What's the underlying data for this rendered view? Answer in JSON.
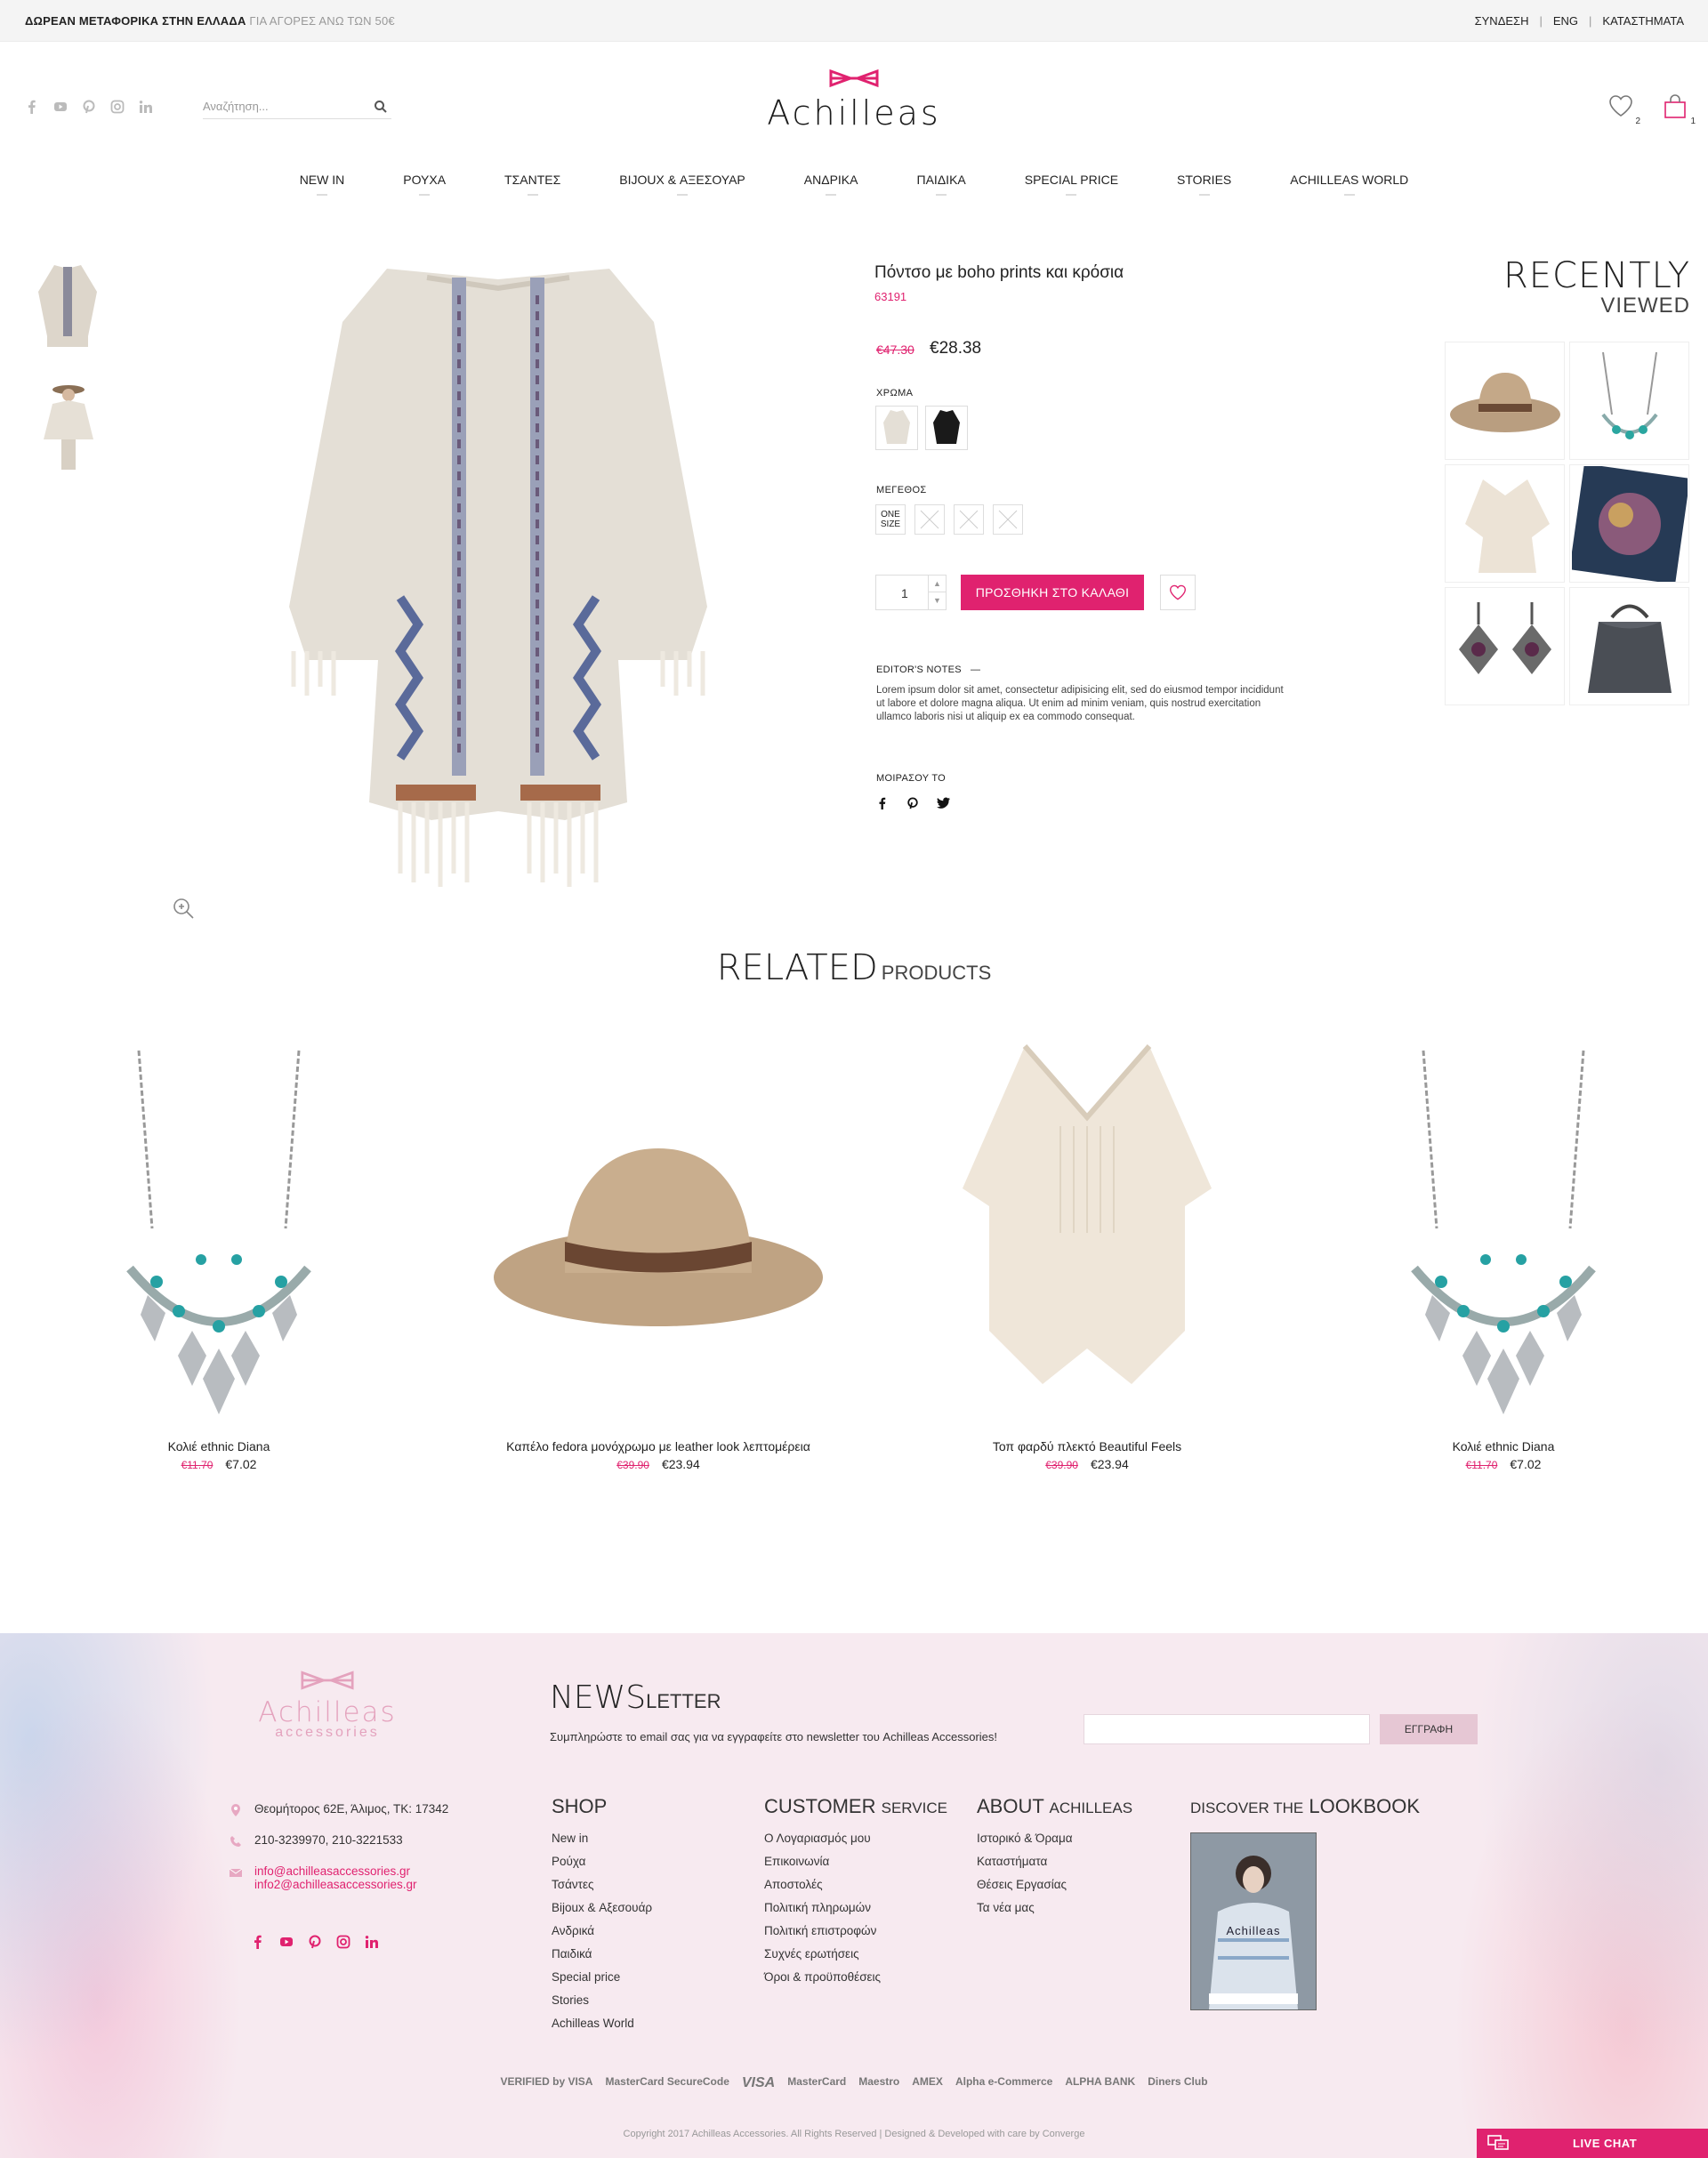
{
  "topbar": {
    "ship_bold": "ΔΩΡΕΑΝ ΜΕΤΑΦΟΡΙΚΑ ΣΤΗΝ ΕΛΛΑΔΑ",
    "ship_thin": "ΓΙΑ ΑΓΟΡΕΣ ΑΝΩ ΤΩΝ 50€",
    "links": [
      "ΣΥΝΔΕΣΗ",
      "ENG",
      "ΚΑΤΑΣΤΗΜΑΤΑ"
    ]
  },
  "header": {
    "search_placeholder": "Αναζήτηση...",
    "logo": "Achilleas",
    "wishlist_count": "2",
    "cart_count": "1",
    "social": [
      "facebook-icon",
      "youtube-icon",
      "pinterest-icon",
      "instagram-icon",
      "linkedin-icon"
    ]
  },
  "nav": [
    "NEW IN",
    "ΡΟΥΧΑ",
    "ΤΣΑΝΤΕΣ",
    "BIJOUX & ΑΞΕΣΟΥΑΡ",
    "ΑΝΔΡΙΚΑ",
    "ΠΑΙΔΙΚΑ",
    "SPECIAL PRICE",
    "STORIES",
    "ACHILLEAS WORLD"
  ],
  "product": {
    "title": "Πόντσο με boho prints και κρόσια",
    "sku": "63191",
    "old_price": "€47.30",
    "price": "€28.38",
    "color_label": "ΧΡΩΜΑ",
    "size_label": "ΜΕΓΕΘΟΣ",
    "size_one": "ONE SIZE",
    "quantity": "1",
    "add_to_cart": "ΠΡΟΣΘΗΚΗ ΣΤΟ ΚΑΛΑΘΙ",
    "notes_label": "EDITOR'S NOTES",
    "notes": "Lorem ipsum dolor sit amet, consectetur adipisicing elit, sed do eiusmod tempor incididunt ut labore et dolore magna aliqua. Ut enim ad minim veniam, quis nostrud exercitation ullamco laboris nisi ut aliquip ex ea commodo consequat.",
    "share_label": "ΜΟΙΡΑΣΟΥ ΤΟ"
  },
  "recently": {
    "title_a": "RECENTLY",
    "title_b": "VIEWED"
  },
  "related": {
    "title_a": "RELATED",
    "title_b": "PRODUCTS",
    "items": [
      {
        "name": "Κολιέ ethnic Diana",
        "old": "€11.70",
        "price": "€7.02"
      },
      {
        "name": "Καπέλο fedora μονόχρωμο με leather look λεπτομέρεια",
        "old": "€39.90",
        "price": "€23.94"
      },
      {
        "name": "Τοπ φαρδύ πλεκτό Beautiful Feels",
        "old": "€39.90",
        "price": "€23.94"
      },
      {
        "name": "Κολιέ ethnic Diana",
        "old": "€11.70",
        "price": "€7.02"
      }
    ]
  },
  "footer": {
    "logo_a": "Achilleas",
    "logo_b": "accessories",
    "nl_title_a": "NEWS",
    "nl_title_b": "LETTER",
    "nl_text": "Συμπληρώστε το email σας για να εγγραφείτε στο newsletter του Achilleas Accessories!",
    "nl_button": "ΕΓΓΡΑΦΗ",
    "address": "Θεομήτορος 62Ε, Άλιμος, ΤΚ: 17342",
    "phones": "210-3239970, 210-3221533",
    "email1": "info@achilleasaccessories.gr",
    "email2": "info2@achilleasaccessories.gr",
    "shop": {
      "title": "SHOP",
      "items": [
        "New in",
        "Ρούχα",
        "Τσάντες",
        "Bijoux & Αξεσουάρ",
        "Ανδρικά",
        "Παιδικά",
        "Special price",
        "Stories",
        "Achilleas World"
      ]
    },
    "customer": {
      "title_a": "CUSTOMER",
      "title_b": "SERVICE",
      "items": [
        "Ο Λογαριασμός μου",
        "Επικοινωνία",
        "Αποστολές",
        "Πολιτική πληρωμών",
        "Πολιτική επιστροφών",
        "Συχνές ερωτήσεις",
        "Όροι & προϋποθέσεις"
      ]
    },
    "about": {
      "title_a": "ABOUT",
      "title_b": "ACHILLEAS",
      "items": [
        "Ιστορικό & Όραμα",
        "Καταστήματα",
        "Θέσεις Εργασίας",
        "Τα νέα μας"
      ]
    },
    "lookbook": {
      "title_a": "DISCOVER THE",
      "title_b": "LOOKBOOK",
      "cover": "Achilleas"
    },
    "payments": [
      "VERIFIED by VISA",
      "MasterCard SecureCode",
      "VISA",
      "MasterCard",
      "Maestro",
      "AMEX",
      "Alpha e-Commerce",
      "ALPHA BANK",
      "Diners Club"
    ],
    "copyright": "Copyright 2017 Achilleas Accessories. All Rights Reserved  |  Designed & Developed with care by Converge",
    "livechat": "LIVE CHAT"
  }
}
